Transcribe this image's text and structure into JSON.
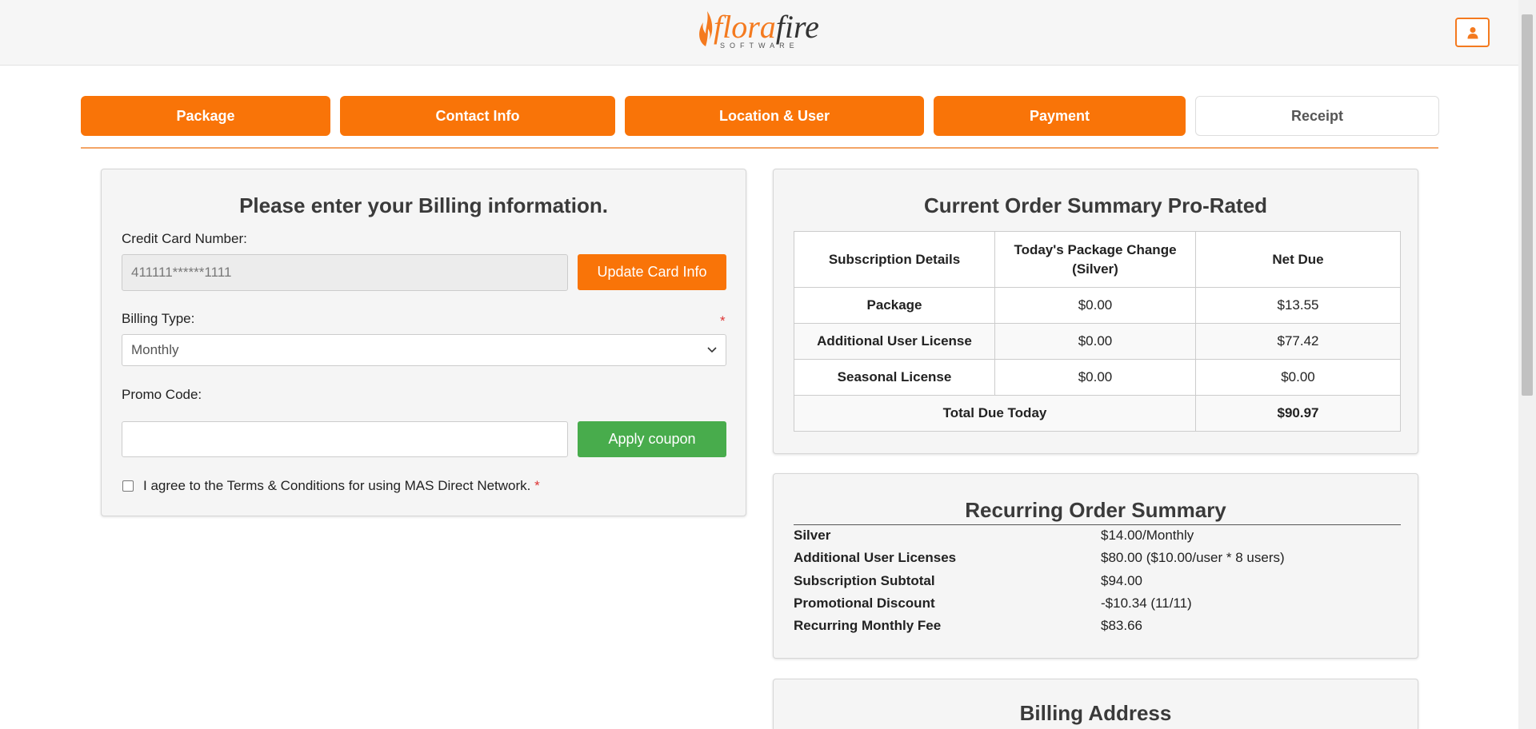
{
  "brand": {
    "logo_primary": "flora",
    "logo_secondary": "fire",
    "logo_sub": "SOFTWARE",
    "accent_color": "#f97408",
    "success_color": "#48ac4c"
  },
  "steps": [
    {
      "label": "Package",
      "state": "complete"
    },
    {
      "label": "Contact Info",
      "state": "complete"
    },
    {
      "label": "Location & User",
      "state": "complete"
    },
    {
      "label": "Payment",
      "state": "current"
    },
    {
      "label": "Receipt",
      "state": "pending"
    }
  ],
  "billing": {
    "title": "Please enter your Billing information.",
    "card_label": "Credit Card Number:",
    "card_value": "411111******1111",
    "update_card_button": "Update Card Info",
    "billing_type_label": "Billing Type:",
    "required_mark": "*",
    "billing_type_value": "Monthly",
    "promo_label": "Promo Code:",
    "promo_value": "",
    "apply_coupon_button": "Apply coupon",
    "terms_text": "I agree to the Terms & Conditions for using MAS Direct Network.",
    "terms_required_mark": "*"
  },
  "order_summary": {
    "title": "Current Order Summary Pro-Rated",
    "headers": [
      "Subscription Details",
      "Today's Package Change (Silver)",
      "Net Due"
    ],
    "rows": [
      {
        "item": "Package",
        "change": "$0.00",
        "net": "$13.55"
      },
      {
        "item": "Additional User License",
        "change": "$0.00",
        "net": "$77.42"
      },
      {
        "item": "Seasonal License",
        "change": "$0.00",
        "net": "$0.00"
      }
    ],
    "total_label": "Total Due Today",
    "total_value": "$90.97"
  },
  "recurring": {
    "title": "Recurring Order Summary",
    "rows": [
      {
        "key": "Silver",
        "value": "$14.00/Monthly"
      },
      {
        "key": "Additional User Licenses",
        "value": "$80.00 ($10.00/user * 8 users)"
      },
      {
        "key": "Subscription Subtotal",
        "value": "$94.00"
      },
      {
        "key": "Promotional Discount",
        "value": "-$10.34 (11/11)"
      },
      {
        "key": "Recurring Monthly Fee",
        "value": "$83.66"
      }
    ]
  },
  "billing_address": {
    "title": "Billing Address"
  }
}
